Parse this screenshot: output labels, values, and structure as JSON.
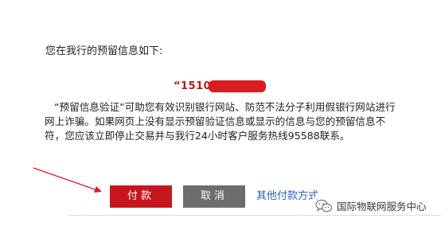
{
  "dialog": {
    "intro_text": "您在我行的预留信息如下:",
    "reserved_code_visible": "“1510",
    "notice_text": "“预留信息验证”可助您有效识别银行网站、防范不法分子利用假银行网站进行网上诈骗。如果网页上没有显示预留验证信息或显示的信息与您的预留信息不符，您应该立即停止交易并与我行24小时客户服务热线95588联系。"
  },
  "actions": {
    "pay_label": "付款",
    "cancel_label": "取消",
    "other_payment_label": "其他付款方式"
  },
  "watermark": {
    "text": "国际物联网服务中心",
    "icon": "wechat-icon"
  },
  "colors": {
    "accent_red": "#c7161e",
    "cancel_gray": "#6d6d6d",
    "link_blue": "#2c63b8",
    "annotation_red": "#d81e1e"
  }
}
